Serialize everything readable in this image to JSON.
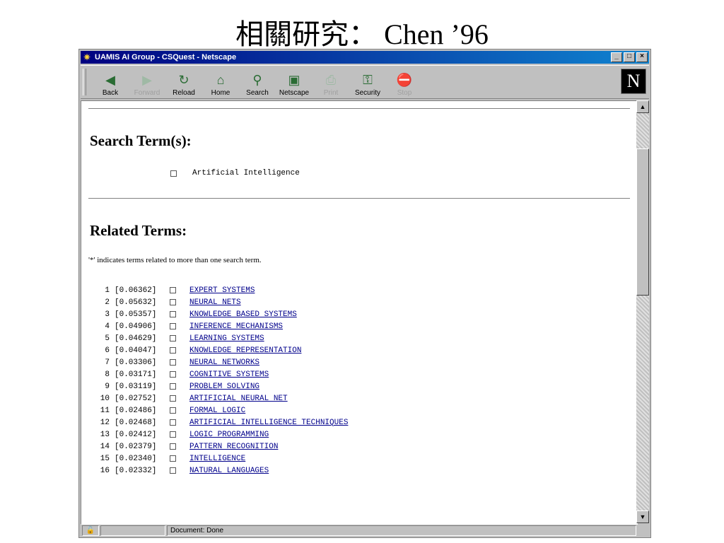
{
  "slide_title": "相關研究： Chen ’96",
  "window": {
    "title": "UAMIS AI Group - CSQuest - Netscape",
    "controls": {
      "minimize": "_",
      "maximize": "□",
      "close": "×"
    }
  },
  "toolbar": {
    "buttons": [
      {
        "label": "Back",
        "icon": "back-arrow-icon",
        "glyph": "◀",
        "enabled": true
      },
      {
        "label": "Forward",
        "icon": "forward-arrow-icon",
        "glyph": "▶",
        "enabled": false
      },
      {
        "label": "Reload",
        "icon": "reload-icon",
        "glyph": "↻",
        "enabled": true
      },
      {
        "label": "Home",
        "icon": "home-icon",
        "glyph": "⌂",
        "enabled": true
      },
      {
        "label": "Search",
        "icon": "search-icon",
        "glyph": "⚲",
        "enabled": true
      },
      {
        "label": "Netscape",
        "icon": "netscape-icon",
        "glyph": "▣",
        "enabled": true
      },
      {
        "label": "Print",
        "icon": "print-icon",
        "glyph": "⎙",
        "enabled": false
      },
      {
        "label": "Security",
        "icon": "lock-icon",
        "glyph": "⚿",
        "enabled": true
      },
      {
        "label": "Stop",
        "icon": "stop-icon",
        "glyph": "⛔",
        "enabled": false
      }
    ],
    "logo": "N"
  },
  "content": {
    "search_heading": "Search Term(s):",
    "search_term": "Artificial Intelligence",
    "related_heading": "Related Terms:",
    "note": "'*' indicates terms related to more than one search term.",
    "related_terms": [
      {
        "num": "1",
        "score": "[0.06362]",
        "term": "EXPERT SYSTEMS"
      },
      {
        "num": "2",
        "score": "[0.05632]",
        "term": "NEURAL NETS"
      },
      {
        "num": "3",
        "score": "[0.05357]",
        "term": "KNOWLEDGE BASED SYSTEMS"
      },
      {
        "num": "4",
        "score": "[0.04906]",
        "term": "INFERENCE MECHANISMS"
      },
      {
        "num": "5",
        "score": "[0.04629]",
        "term": "LEARNING SYSTEMS"
      },
      {
        "num": "6",
        "score": "[0.04047]",
        "term": "KNOWLEDGE REPRESENTATION"
      },
      {
        "num": "7",
        "score": "[0.03306]",
        "term": "NEURAL NETWORKS"
      },
      {
        "num": "8",
        "score": "[0.03171]",
        "term": "COGNITIVE SYSTEMS"
      },
      {
        "num": "9",
        "score": "[0.03119]",
        "term": "PROBLEM SOLVING"
      },
      {
        "num": "10",
        "score": "[0.02752]",
        "term": "ARTIFICIAL NEURAL NET"
      },
      {
        "num": "11",
        "score": "[0.02486]",
        "term": "FORMAL LOGIC"
      },
      {
        "num": "12",
        "score": "[0.02468]",
        "term": "ARTIFICIAL INTELLIGENCE TECHNIQUES"
      },
      {
        "num": "13",
        "score": "[0.02412]",
        "term": "LOGIC PROGRAMMING"
      },
      {
        "num": "14",
        "score": "[0.02379]",
        "term": "PATTERN RECOGNITION"
      },
      {
        "num": "15",
        "score": "[0.02340]",
        "term": "INTELLIGENCE"
      },
      {
        "num": "16",
        "score": "[0.02332]",
        "term": "NATURAL LANGUAGES"
      }
    ]
  },
  "statusbar": {
    "text": "Document: Done"
  },
  "colors": {
    "titlebar": "#000080",
    "link": "#00008b",
    "chrome": "#c0c0c0"
  }
}
